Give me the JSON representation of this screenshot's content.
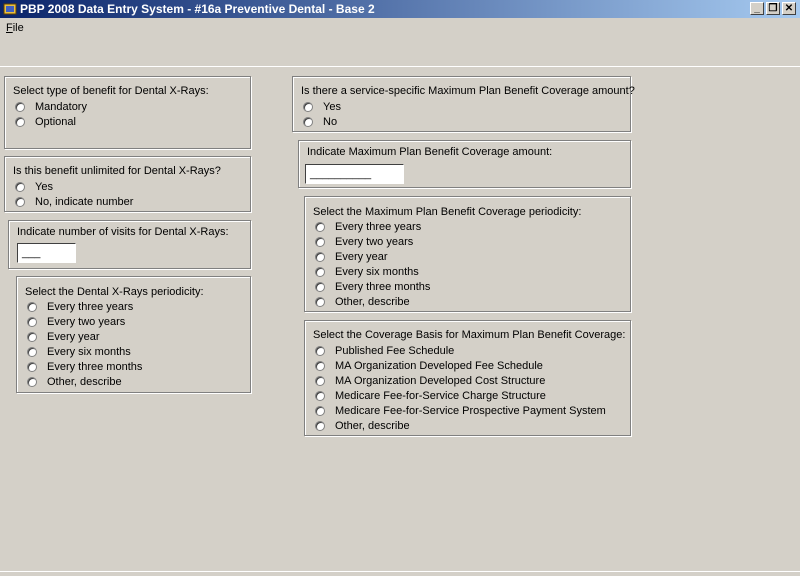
{
  "window": {
    "title": "PBP 2008 Data Entry System - #16a Preventive Dental - Base 2",
    "controls": {
      "minimize": "_",
      "restore": "❐",
      "close": "✕"
    }
  },
  "menu": {
    "file_label_underlined": "F",
    "file_label_rest": "ile"
  },
  "benefit_type": {
    "prompt": "Select type of benefit for Dental X-Rays:",
    "options": [
      "Mandatory",
      "Optional"
    ]
  },
  "unlimited": {
    "prompt": "Is this benefit unlimited for Dental X-Rays?",
    "options": [
      "Yes",
      "No, indicate number"
    ]
  },
  "visits": {
    "prompt": "Indicate number of visits for Dental X-Rays:",
    "value": "___"
  },
  "xray_periodicity": {
    "prompt": "Select the Dental X-Rays periodicity:",
    "options": [
      "Every three years",
      "Every two years",
      "Every year",
      "Every six months",
      "Every three months",
      "Other, describe"
    ]
  },
  "max_coverage": {
    "prompt": "Is there a service-specific Maximum Plan Benefit Coverage amount?",
    "options": [
      "Yes",
      "No"
    ]
  },
  "max_amount": {
    "prompt": "Indicate Maximum Plan Benefit Coverage amount:",
    "value": "__________"
  },
  "max_periodicity": {
    "prompt": "Select the Maximum Plan Benefit Coverage periodicity:",
    "options": [
      "Every three years",
      "Every two years",
      "Every year",
      "Every six months",
      "Every three months",
      "Other, describe"
    ]
  },
  "coverage_basis": {
    "prompt": "Select the Coverage Basis for Maximum Plan Benefit Coverage:",
    "options": [
      "Published Fee Schedule",
      "MA Organization Developed Fee Schedule",
      "MA Organization Developed Cost Structure",
      "Medicare Fee-for-Service Charge Structure",
      "Medicare Fee-for-Service Prospective Payment System",
      "Other, describe"
    ]
  }
}
